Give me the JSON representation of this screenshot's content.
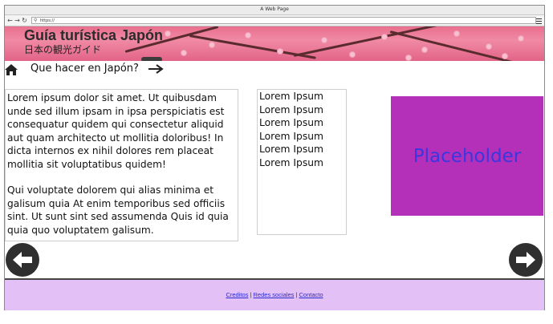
{
  "window": {
    "title": "A Web Page"
  },
  "browser": {
    "url": "https://"
  },
  "banner": {
    "title": "Guía turística Japón",
    "subtitle": "日本の観光ガイド"
  },
  "subnav": {
    "link_label": "Que hacer en Japón?"
  },
  "content": {
    "paragraphs": [
      "Lorem ipsum dolor sit amet. Ut quibusdam unde sed illum ipsam in ipsa perspiciatis est consequatur quidem qui consectetur aliquid aut quam architecto ut mollitia doloribus! In dicta internos ex nihil dolores rem placeat mollitia sit voluptatibus quidem!",
      "Qui voluptate dolorem qui alias minima et galisum quia At enim temporibus sed officiis sint. Ut sunt sint sed assumenda Quis id quia quia quo voluptatem galisum."
    ],
    "list_items": [
      "Lorem Ipsum",
      "Lorem Ipsum",
      "Lorem Ipsum",
      "Lorem Ipsum",
      "Lorem Ipsum",
      "Lorem Ipsum"
    ],
    "placeholder": "Placeholder"
  },
  "footer": {
    "links": [
      "Creditos",
      "Redes sociales",
      "Contacto"
    ],
    "separator": "|"
  },
  "colors": {
    "placeholder_bg": "#b430b8",
    "placeholder_text": "#3a36e0",
    "footer_bg": "#e3c0f5",
    "banner_pink": "#e86f8e"
  },
  "icons": [
    "back-icon",
    "forward-icon",
    "reload-icon",
    "lock-icon",
    "menu-icon",
    "home-icon",
    "arrow-right-icon",
    "arrow-left-circle-icon",
    "arrow-right-circle-icon"
  ]
}
